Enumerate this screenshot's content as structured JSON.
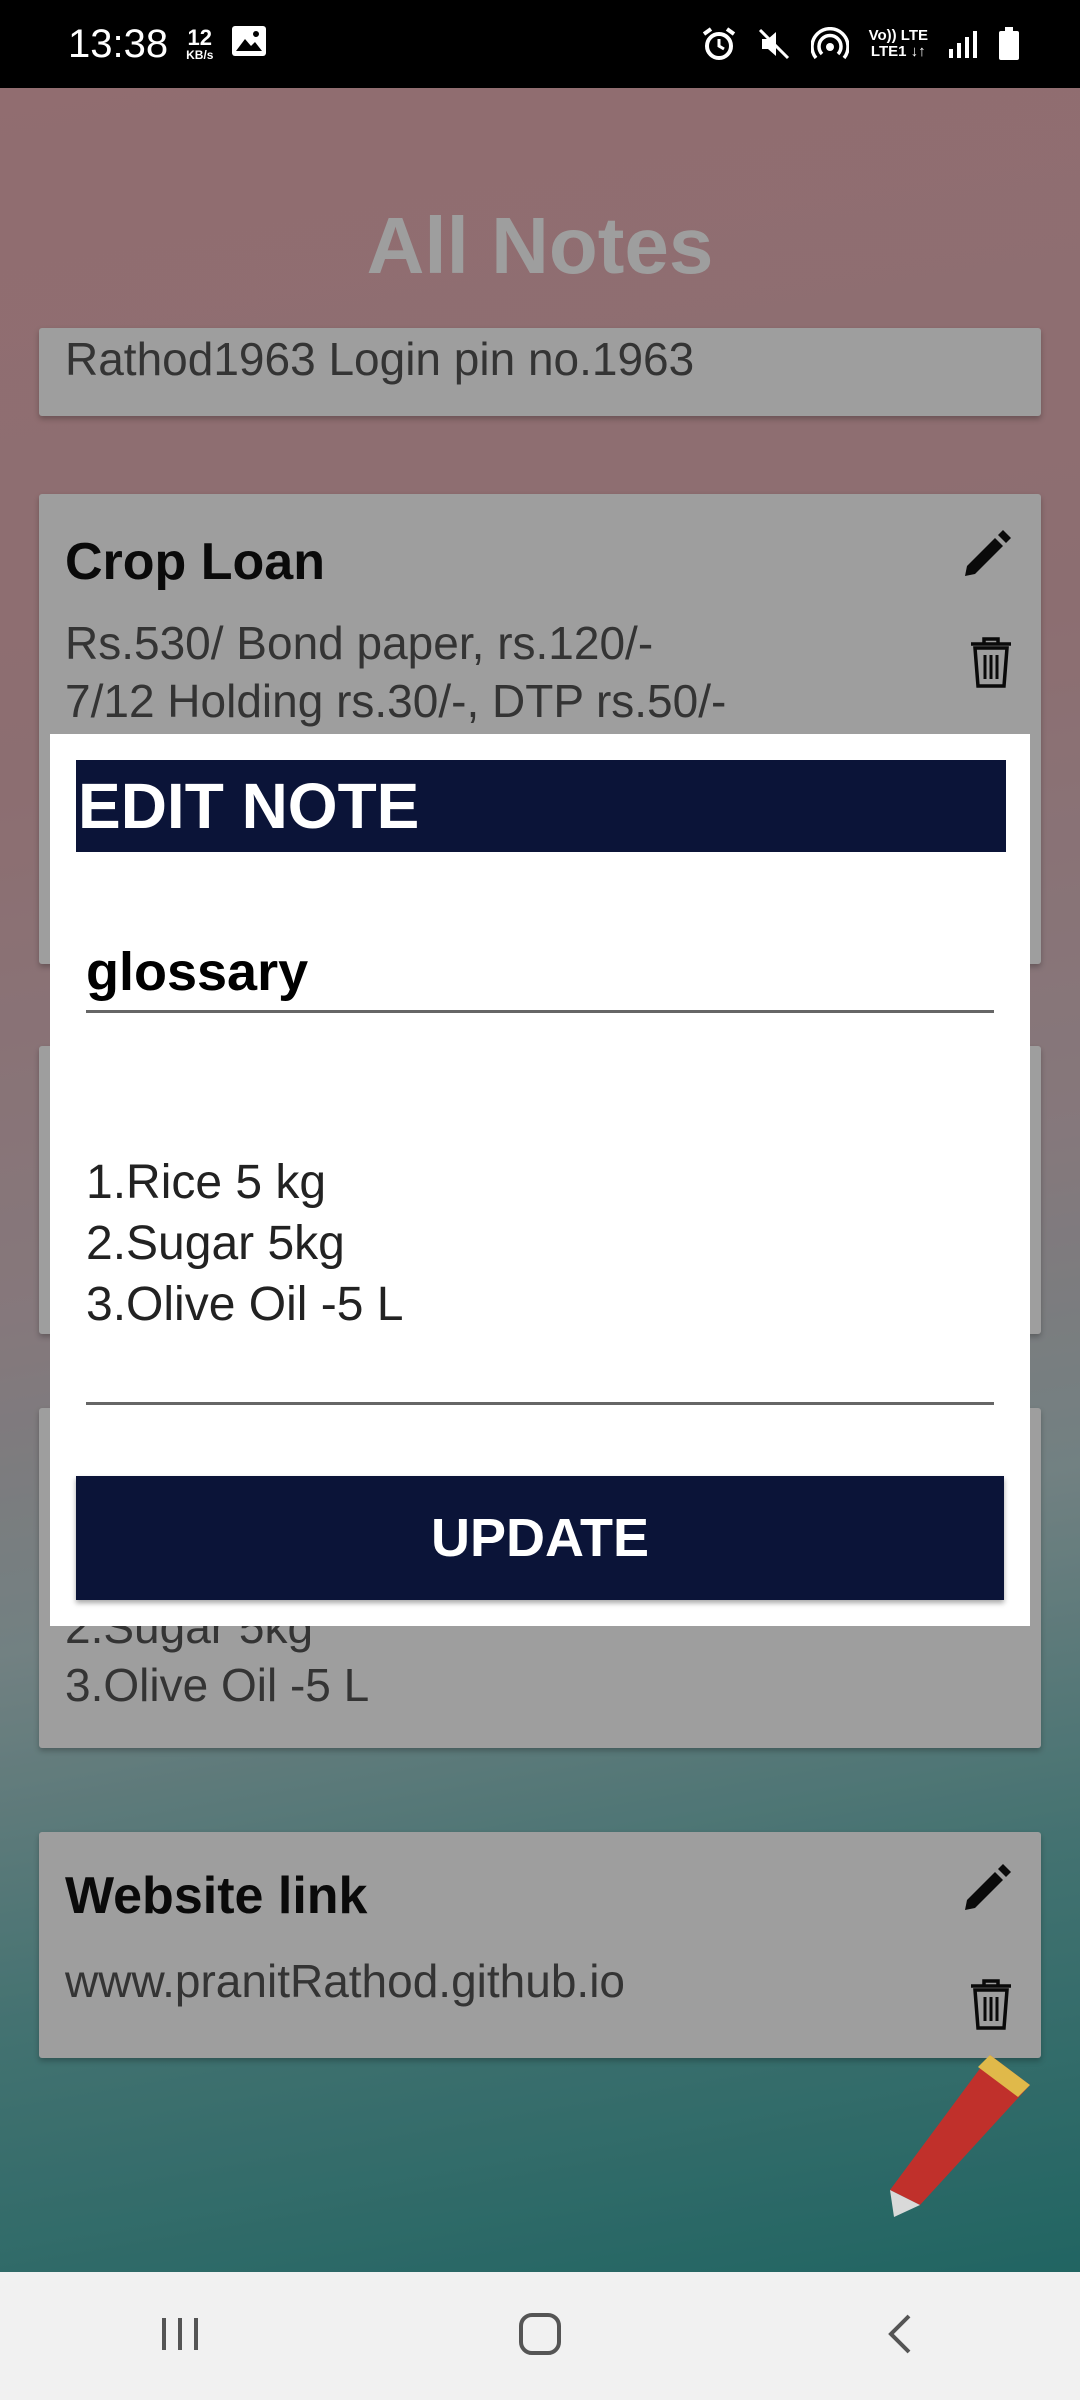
{
  "status_bar": {
    "time": "13:38",
    "net_speed_value": "12",
    "net_speed_unit": "KB/s",
    "lte_top": "Vo)) LTE",
    "lte_bottom": "LTE1 ↓↑"
  },
  "app": {
    "title": "All Notes",
    "notes": [
      {
        "title": "",
        "body": "Rathod1963 Login pin no.1963"
      },
      {
        "title": "Crop Loan",
        "body": "Rs.530/ Bond paper, rs.120/-\n7/12 Holding rs.30/-, DTP rs.50/-"
      },
      {
        "title": "",
        "body": ""
      },
      {
        "title": "",
        "body": "2.Sugar 5kg\n3.Olive Oil -5 L"
      },
      {
        "title": "Website link",
        "body": "www.pranitRathod.github.io"
      }
    ]
  },
  "dialog": {
    "header": "EDIT NOTE",
    "title_value": "glossary",
    "body_value": "1.Rice 5 kg\n2.Sugar 5kg\n3.Olive Oil -5 L",
    "update_label": "UPDATE"
  },
  "icons": {
    "edit": "pencil-icon",
    "delete": "trash-icon",
    "fab": "pencil-icon",
    "nav_recent": "recents-icon",
    "nav_home": "home-icon",
    "nav_back": "back-icon"
  },
  "colors": {
    "dialog_header": "#0b1438",
    "update_button": "#0b1438",
    "fab_body": "#c0302b",
    "fab_tip": "#e0b94a"
  }
}
